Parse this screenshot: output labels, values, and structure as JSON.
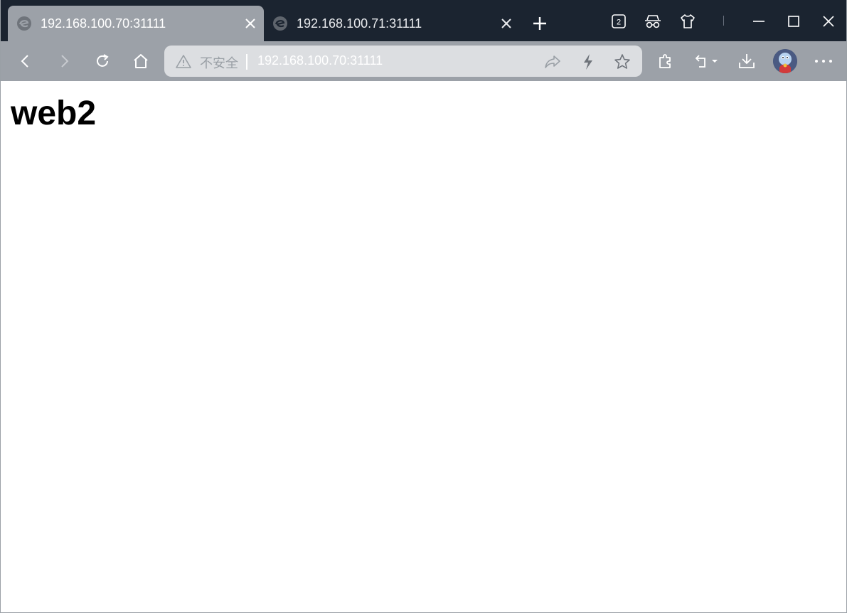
{
  "browser": {
    "tabs": [
      {
        "title": "192.168.100.70:31111",
        "active": true
      },
      {
        "title": "192.168.100.71:31111",
        "active": false
      }
    ],
    "tab_count_badge": "2",
    "address_bar": {
      "security_label": "不安全",
      "url": "192.168.100.70:31111"
    }
  },
  "page": {
    "heading": "web2"
  },
  "colors": {
    "tabstrip": "#1b2430",
    "toolbar": "#9ca1a8",
    "omnibox": "#dcdee1",
    "page_background": "#ffffff"
  },
  "icons": {
    "favicon": "browser-e-logo-icon",
    "close": "close-icon",
    "new_tab": "plus-icon",
    "tab_actions": "tab-count-icon",
    "incognito": "incognito-icon",
    "skin": "shirt-icon",
    "minimize": "minimize-icon",
    "maximize": "maximize-icon",
    "window_close": "window-close-icon",
    "back": "back-arrow-icon",
    "forward": "forward-arrow-icon",
    "reload": "reload-icon",
    "home": "home-icon",
    "warning": "warning-icon",
    "share": "share-icon",
    "flash": "lightning-icon",
    "favorite": "star-icon",
    "extensions": "puzzle-icon",
    "undo": "undo-dropdown-icon",
    "download": "download-icon",
    "profile": "avatar",
    "menu": "more-icon"
  }
}
